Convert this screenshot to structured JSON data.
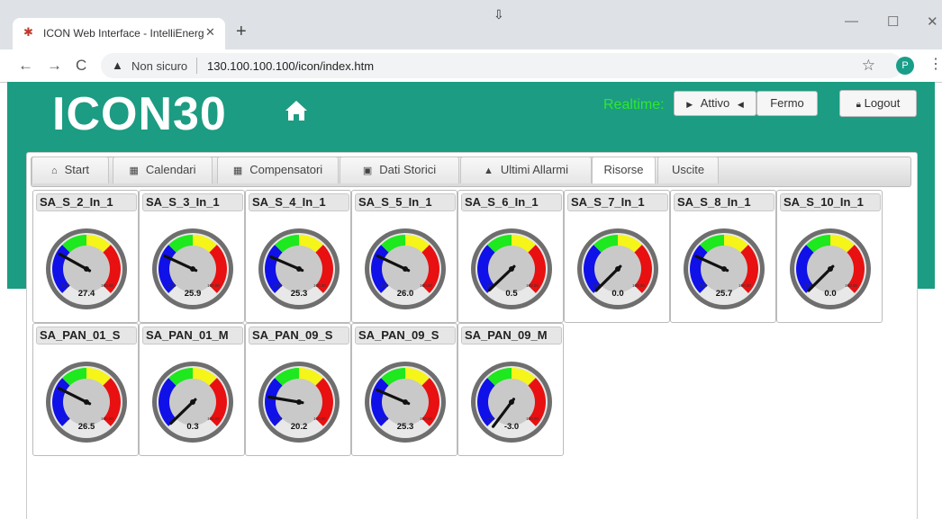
{
  "browser": {
    "tab_title": "ICON Web Interface - IntelliEnerg",
    "tab_close": "✕",
    "new_tab": "+",
    "security_warning": "Non sicuro",
    "url": "130.100.100.100/icon/index.htm",
    "profile_initial": "P"
  },
  "header": {
    "logo": "ICON30",
    "realtime_label": "Realtime:",
    "attivo_label": "Attivo",
    "fermo_label": "Fermo",
    "logout_label": "Logout"
  },
  "tabs": [
    {
      "label": "Start",
      "icon": "home-icon"
    },
    {
      "label": "Calendari",
      "icon": "table-icon"
    },
    {
      "label": "Compensatori",
      "icon": "table-icon"
    },
    {
      "label": "Dati Storici",
      "icon": "image-icon"
    },
    {
      "label": "Ultimi Allarmi",
      "icon": "warning-icon"
    },
    {
      "label": "Risorse",
      "active": true
    },
    {
      "label": "Uscite"
    }
  ],
  "gauges": [
    {
      "label": "SA_S_2_In_1",
      "value": "27.4",
      "needle": 27.4
    },
    {
      "label": "SA_S_3_In_1",
      "value": "25.9",
      "needle": 25.9
    },
    {
      "label": "SA_S_4_In_1",
      "value": "25.3",
      "needle": 25.3
    },
    {
      "label": "SA_S_5_In_1",
      "value": "26.0",
      "needle": 26.0
    },
    {
      "label": "SA_S_6_In_1",
      "value": "0.5",
      "needle": 0.5
    },
    {
      "label": "SA_S_7_In_1",
      "value": "0.0",
      "needle": 0.0
    },
    {
      "label": "SA_S_8_In_1",
      "value": "25.7",
      "needle": 25.7
    },
    {
      "label": "SA_S_10_In_1",
      "value": "0.0",
      "needle": 0.0
    },
    {
      "label": "SA_PAN_01_S",
      "value": "26.5",
      "needle": 26.5
    },
    {
      "label": "SA_PAN_01_M",
      "value": "0.3",
      "needle": 0.3
    },
    {
      "label": "SA_PAN_09_S",
      "value": "20.2",
      "needle": 20.2
    },
    {
      "label": "SA_PAN_09_S",
      "value": "25.3",
      "needle": 25.3
    },
    {
      "label": "SA_PAN_09_M",
      "value": "-3.0",
      "needle": -3.0
    }
  ],
  "gauge_scale": {
    "min_label": "0.00",
    "max_label": "100.00",
    "min": 0,
    "max": 100
  },
  "colors": {
    "header_bg": "#1c9c82",
    "realtime": "#2ee82e",
    "zone_low": "#1010e8",
    "zone_mid_low": "#1ee81e",
    "zone_mid_high": "#f5f51a",
    "zone_high": "#e81010"
  }
}
